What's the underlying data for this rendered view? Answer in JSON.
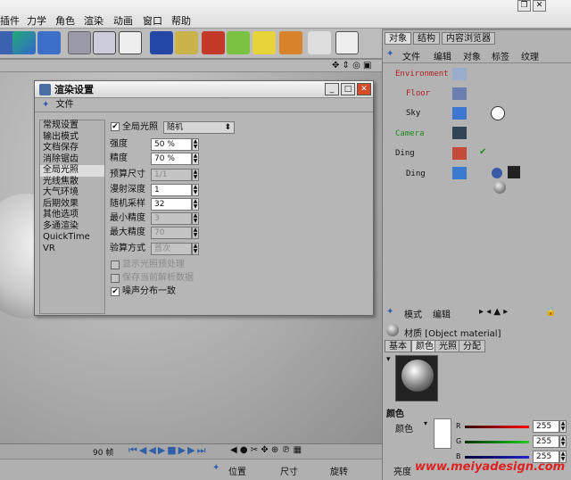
{
  "menubar": {
    "items": [
      "插件",
      "力学",
      "角色",
      "渲染",
      "动画",
      "窗口",
      "帮助"
    ]
  },
  "viewport": {
    "timeline_frame": "90 帧"
  },
  "coords": {
    "pos": "位置",
    "size": "尺寸",
    "rot": "旋转"
  },
  "dialog": {
    "title": "渲染设置",
    "menu_file": "文件",
    "categories": [
      "常规设置",
      "输出模式",
      "文档保存",
      "消除锯齿",
      "全局光照",
      "光线焦散",
      "大气环境",
      "后期效果",
      "其他选项",
      "多通渲染",
      "QuickTime VR"
    ],
    "selected_category": "全局光照",
    "gi_label": "全局光照",
    "gi_mode": "随机",
    "strength_label": "强度",
    "strength": "50 %",
    "accuracy_label": "精度",
    "accuracy": "70 %",
    "prepass_label": "预算尺寸",
    "prepass": "1/1",
    "depth_label": "漫射深度",
    "depth": "1",
    "samples_label": "随机采样",
    "samples": "32",
    "min_label": "最小精度",
    "min": "3",
    "max_label": "最大精度",
    "max": "70",
    "method_label": "验算方式",
    "method": "首次",
    "chk_show": "显示光照预处理",
    "chk_save": "保存当前解析数据",
    "chk_noise": "噪声分布一致"
  },
  "objects": {
    "tabs": [
      "对象",
      "结构",
      "内容浏览器"
    ],
    "menu": [
      "文件",
      "编辑",
      "对象",
      "标签",
      "纹理"
    ],
    "items": [
      "Environment",
      "Floor",
      "Sky",
      "Camera",
      "Ding",
      "Ding"
    ]
  },
  "material": {
    "menu": [
      "模式",
      "编辑"
    ],
    "name": "材质 [Object material]",
    "tabs": [
      "基本",
      "颜色",
      "光照",
      "分配"
    ],
    "section": "颜色",
    "color_label": "颜色",
    "r_label": "R",
    "g_label": "G",
    "b_label": "B",
    "r": "255",
    "g": "255",
    "b": "255",
    "brightness_label": "亮度",
    "watermark": "www.meiyadesign.com"
  },
  "colors": {
    "accent": "#2f5fa8",
    "env": "#b02020",
    "camera": "#1a8a1a"
  }
}
